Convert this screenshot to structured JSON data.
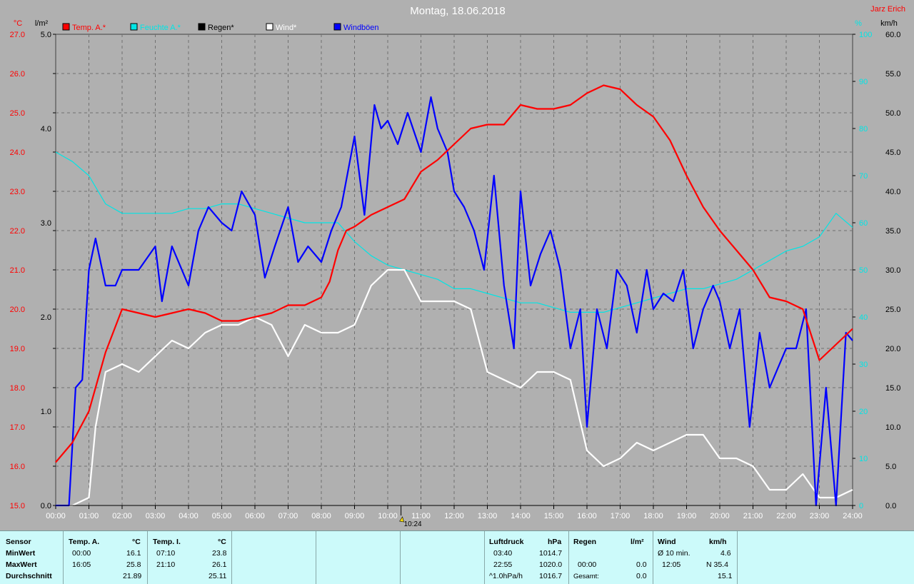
{
  "title": "Montag, 18.06.2018",
  "author": "Jarz Erich",
  "colors": {
    "background": "#b0b0b0",
    "temp": "#ff0000",
    "humidity": "#00e5e5",
    "rain": "#000000",
    "wind": "#ffffff",
    "gusts": "#0000ff"
  },
  "axes": {
    "left1_unit": "°C",
    "left2_unit": "l/m²",
    "right1_unit": "%",
    "right2_unit": "km/h",
    "temp_ticks": [
      "27.0",
      "26.0",
      "25.0",
      "24.0",
      "23.0",
      "22.0",
      "21.0",
      "20.0",
      "19.0",
      "18.0",
      "17.0",
      "16.0",
      "15.0"
    ],
    "rain_ticks": [
      "5.0",
      "4.0",
      "3.0",
      "2.0",
      "1.0",
      "0.0"
    ],
    "hum_ticks": [
      "100",
      "90",
      "80",
      "70",
      "60",
      "50",
      "40",
      "30",
      "20",
      "10",
      "0"
    ],
    "wind_ticks": [
      "60.0",
      "55.0",
      "50.0",
      "45.0",
      "40.0",
      "35.0",
      "30.0",
      "25.0",
      "20.0",
      "15.0",
      "10.0",
      "5.0",
      "0.0"
    ],
    "time_ticks": [
      "00:00",
      "01:00",
      "02:00",
      "03:00",
      "04:00",
      "05:00",
      "06:00",
      "07:00",
      "08:00",
      "09:00",
      "10:00",
      "11:00",
      "12:00",
      "13:00",
      "14:00",
      "15:00",
      "16:00",
      "17:00",
      "18:00",
      "19:00",
      "20:00",
      "21:00",
      "22:00",
      "23:00",
      "24:00"
    ],
    "marker_label": "10:24"
  },
  "chart_data": {
    "type": "line",
    "title": "Montag, 18.06.2018",
    "x_unit": "hours",
    "xlim": [
      0,
      24
    ],
    "temp_ylim": [
      15,
      27
    ],
    "rain_ylim": [
      0,
      5
    ],
    "hum_ylim": [
      0,
      100
    ],
    "wind_ylim": [
      0,
      60
    ],
    "legend": [
      "Temp. A.*",
      "Feuchte A.*",
      "Regen*",
      "Wind*",
      "Windböen"
    ],
    "series": [
      {
        "name": "Temp. A.*",
        "axis": "temp",
        "color": "#ff0000",
        "x": [
          0,
          0.5,
          1,
          1.5,
          2,
          2.5,
          3,
          3.5,
          4,
          4.5,
          5,
          5.5,
          6,
          6.5,
          7,
          7.5,
          8,
          8.25,
          8.5,
          8.75,
          9,
          9.5,
          10,
          10.5,
          11,
          11.5,
          12,
          12.5,
          13,
          13.5,
          14,
          14.5,
          15,
          15.5,
          16,
          16.5,
          17,
          17.5,
          18,
          18.5,
          19,
          19.5,
          20,
          20.5,
          21,
          21.5,
          22,
          22.5,
          23,
          23.5,
          24
        ],
        "y": [
          16.1,
          16.6,
          17.4,
          18.9,
          20.0,
          19.9,
          19.8,
          19.9,
          20.0,
          19.9,
          19.7,
          19.7,
          19.8,
          19.9,
          20.1,
          20.1,
          20.3,
          20.7,
          21.5,
          22.0,
          22.1,
          22.4,
          22.6,
          22.8,
          23.5,
          23.8,
          24.2,
          24.6,
          24.7,
          24.7,
          25.2,
          25.1,
          25.1,
          25.2,
          25.5,
          25.7,
          25.6,
          25.2,
          24.9,
          24.3,
          23.4,
          22.6,
          22.0,
          21.5,
          21.0,
          20.3,
          20.2,
          20.0,
          18.7,
          19.1,
          19.5
        ]
      },
      {
        "name": "Feuchte A.*",
        "axis": "hum",
        "color": "#00e5e5",
        "x": [
          0,
          0.5,
          1,
          1.5,
          2,
          2.5,
          3,
          3.5,
          4,
          4.5,
          5,
          5.5,
          6,
          6.5,
          7,
          7.5,
          8,
          8.5,
          9,
          9.5,
          10,
          10.5,
          11,
          11.5,
          12,
          12.5,
          13,
          13.5,
          14,
          14.5,
          15,
          15.5,
          16,
          16.5,
          17,
          17.5,
          18,
          18.5,
          19,
          19.5,
          20,
          20.5,
          21,
          21.5,
          22,
          22.5,
          23,
          23.5,
          24
        ],
        "y": [
          75,
          73,
          70,
          64,
          62,
          62,
          62,
          62,
          63,
          63,
          64,
          64,
          63,
          62,
          61,
          60,
          60,
          60,
          56,
          53,
          51,
          50,
          49,
          48,
          46,
          46,
          45,
          44,
          43,
          43,
          42,
          41,
          41,
          41,
          42,
          43,
          44,
          45,
          46,
          46,
          47,
          48,
          50,
          52,
          54,
          55,
          57,
          62,
          59
        ]
      },
      {
        "name": "Regen*",
        "axis": "rain",
        "color": "#000000",
        "x": [
          0,
          24
        ],
        "y": [
          0,
          0
        ]
      },
      {
        "name": "Wind*",
        "axis": "wind",
        "color": "#ffffff",
        "x": [
          0,
          0.5,
          1,
          1.2,
          1.5,
          2,
          2.5,
          3,
          3.5,
          4,
          4.5,
          5,
          5.5,
          6,
          6.5,
          7,
          7.5,
          8,
          8.5,
          9,
          9.5,
          10,
          10.5,
          11,
          11.5,
          12,
          12.5,
          13,
          13.5,
          14,
          14.5,
          15,
          15.5,
          16,
          16.5,
          17,
          17.5,
          18,
          18.5,
          19,
          19.5,
          20,
          20.5,
          21,
          21.5,
          22,
          22.5,
          23,
          23.5,
          24
        ],
        "y": [
          0,
          0,
          1,
          10,
          17,
          18,
          17,
          19,
          21,
          20,
          22,
          23,
          23,
          24,
          23,
          19,
          23,
          22,
          22,
          23,
          28,
          30,
          30,
          26,
          26,
          26,
          25,
          17,
          16,
          15,
          17,
          17,
          16,
          7,
          5,
          6,
          8,
          7,
          8,
          9,
          9,
          6,
          6,
          5,
          2,
          2,
          4,
          1,
          1,
          2
        ]
      },
      {
        "name": "Windböen",
        "axis": "wind",
        "color": "#0000ff",
        "x": [
          0,
          0.4,
          0.6,
          0.8,
          1,
          1.2,
          1.5,
          1.8,
          2,
          2.5,
          3,
          3.2,
          3.5,
          3.8,
          4,
          4.3,
          4.6,
          5,
          5.3,
          5.6,
          6,
          6.3,
          6.6,
          7,
          7.3,
          7.6,
          8,
          8.3,
          8.6,
          9,
          9.3,
          9.6,
          9.8,
          10,
          10.3,
          10.6,
          11,
          11.3,
          11.5,
          11.8,
          12,
          12.3,
          12.6,
          12.9,
          13.2,
          13.5,
          13.8,
          14,
          14.3,
          14.6,
          14.9,
          15.2,
          15.5,
          15.8,
          16,
          16.3,
          16.6,
          16.9,
          17.2,
          17.5,
          17.8,
          18,
          18.3,
          18.6,
          18.9,
          19.2,
          19.5,
          19.8,
          20,
          20.3,
          20.6,
          20.9,
          21.2,
          21.5,
          21.8,
          22,
          22.3,
          22.6,
          22.9,
          23.2,
          23.5,
          23.8,
          24
        ],
        "y": [
          0,
          0,
          15,
          16,
          30,
          34,
          28,
          28,
          30,
          30,
          33,
          26,
          33,
          30,
          28,
          35,
          38,
          36,
          35,
          40,
          37,
          29,
          33,
          38,
          31,
          33,
          31,
          35,
          38,
          47,
          37,
          51,
          48,
          49,
          46,
          50,
          45,
          52,
          48,
          45,
          40,
          38,
          35,
          30,
          42,
          28,
          20,
          40,
          28,
          32,
          35,
          30,
          20,
          25,
          10,
          25,
          20,
          30,
          28,
          22,
          30,
          25,
          27,
          26,
          30,
          20,
          25,
          28,
          26,
          20,
          25,
          10,
          22,
          15,
          18,
          20,
          20,
          25,
          0,
          15,
          0,
          22,
          21
        ]
      }
    ]
  },
  "stats": {
    "sensor": {
      "header": "Sensor",
      "rows": [
        "MinWert",
        "MaxWert",
        "Durchschnitt"
      ]
    },
    "tempA": {
      "header": "Temp. A.",
      "unit": "°C",
      "min_time": "00:00",
      "min_val": "16.1",
      "max_time": "16:05",
      "max_val": "25.8",
      "avg": "21.89"
    },
    "tempI": {
      "header": "Temp. I.",
      "unit": "°C",
      "min_time": "07:10",
      "min_val": "23.8",
      "max_time": "21:10",
      "max_val": "26.1",
      "avg": "25.11"
    },
    "pressure": {
      "header": "Luftdruck",
      "unit": "hPa",
      "min_time": "03:40",
      "min_val": "1014.7",
      "max_time": "22:55",
      "max_val": "1020.0",
      "trend_label": "^1.0hPa/h",
      "trend_val": "1016.7"
    },
    "rain": {
      "header": "Regen",
      "unit": "l/m²",
      "max_time": "00:00",
      "max_val": "0.0",
      "total_label": "Gesamt:",
      "total_val": "0.0"
    },
    "wind": {
      "header": "Wind",
      "unit": "km/h",
      "avg_label": "Ø 10 min.",
      "avg_val": "4.6",
      "max_time": "12:05",
      "max_val": "N 35.4",
      "day_avg": "15.1"
    }
  }
}
